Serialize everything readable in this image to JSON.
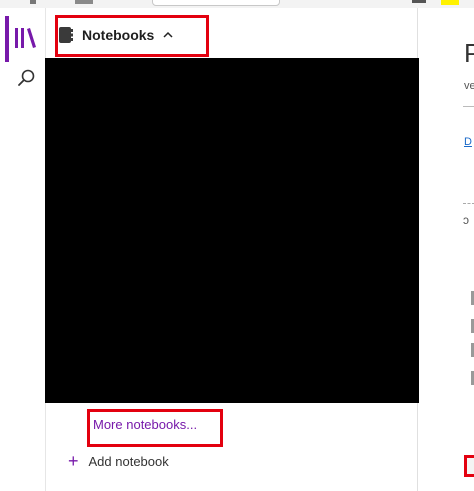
{
  "panel": {
    "header_label": "Notebooks",
    "chevron": "^",
    "more_notebooks": "More notebooks...",
    "add_notebook": "Add notebook",
    "add_icon": "+"
  },
  "rail": {
    "items": [
      {
        "name": "library-icon",
        "selected": true
      },
      {
        "name": "search-icon",
        "selected": false
      }
    ]
  },
  "page_area": {
    "title_fragment": "P",
    "sub_fragment": "ve",
    "link_fragment": "D",
    "char_fragment": "ᴐ"
  },
  "colors": {
    "accent": "#7719aa",
    "highlight": "#e3000f",
    "redacted": "#000000"
  }
}
